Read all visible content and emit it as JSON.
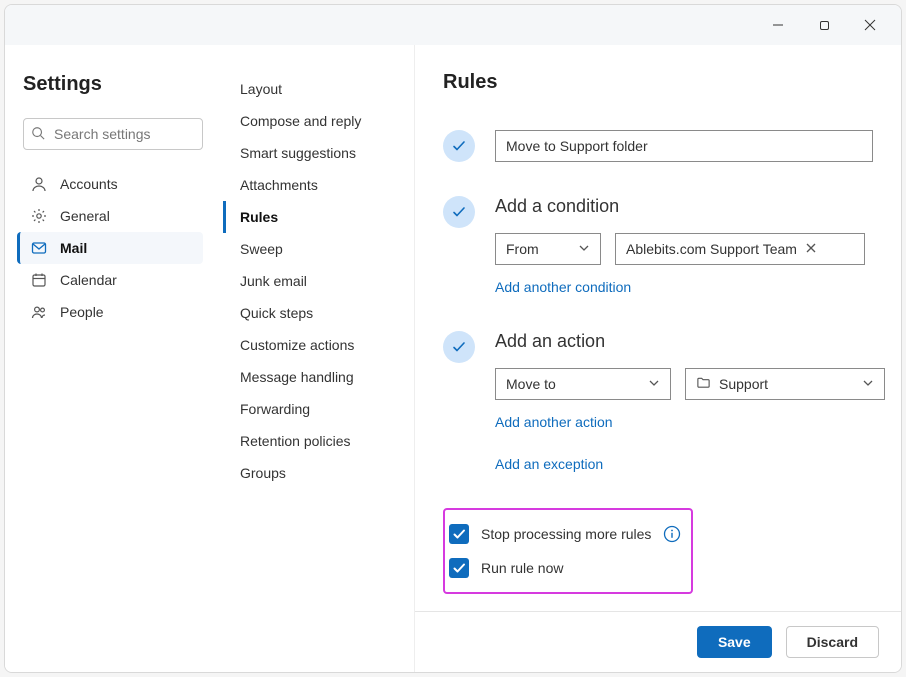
{
  "window": {
    "title": "Settings"
  },
  "search": {
    "placeholder": "Search settings"
  },
  "nav": {
    "items": [
      {
        "label": "Accounts",
        "icon": "person"
      },
      {
        "label": "General",
        "icon": "gear"
      },
      {
        "label": "Mail",
        "icon": "mail",
        "active": true
      },
      {
        "label": "Calendar",
        "icon": "calendar"
      },
      {
        "label": "People",
        "icon": "people"
      }
    ]
  },
  "subnav": {
    "items": [
      {
        "label": "Layout"
      },
      {
        "label": "Compose and reply"
      },
      {
        "label": "Smart suggestions"
      },
      {
        "label": "Attachments"
      },
      {
        "label": "Rules",
        "active": true
      },
      {
        "label": "Sweep"
      },
      {
        "label": "Junk email"
      },
      {
        "label": "Quick steps"
      },
      {
        "label": "Customize actions"
      },
      {
        "label": "Message handling"
      },
      {
        "label": "Forwarding"
      },
      {
        "label": "Retention policies"
      },
      {
        "label": "Groups"
      }
    ]
  },
  "main": {
    "title": "Rules",
    "rule_name": "Move to Support folder",
    "condition": {
      "heading": "Add a condition",
      "selector_label": "From",
      "chip": "Ablebits.com Support Team",
      "add_another": "Add another condition"
    },
    "action": {
      "heading": "Add an action",
      "selector_label": "Move to",
      "folder_label": "Support",
      "add_another": "Add another action",
      "add_exception": "Add an exception"
    },
    "options": {
      "stop_processing": "Stop processing more rules",
      "run_now": "Run rule now"
    }
  },
  "footer": {
    "save": "Save",
    "discard": "Discard"
  }
}
